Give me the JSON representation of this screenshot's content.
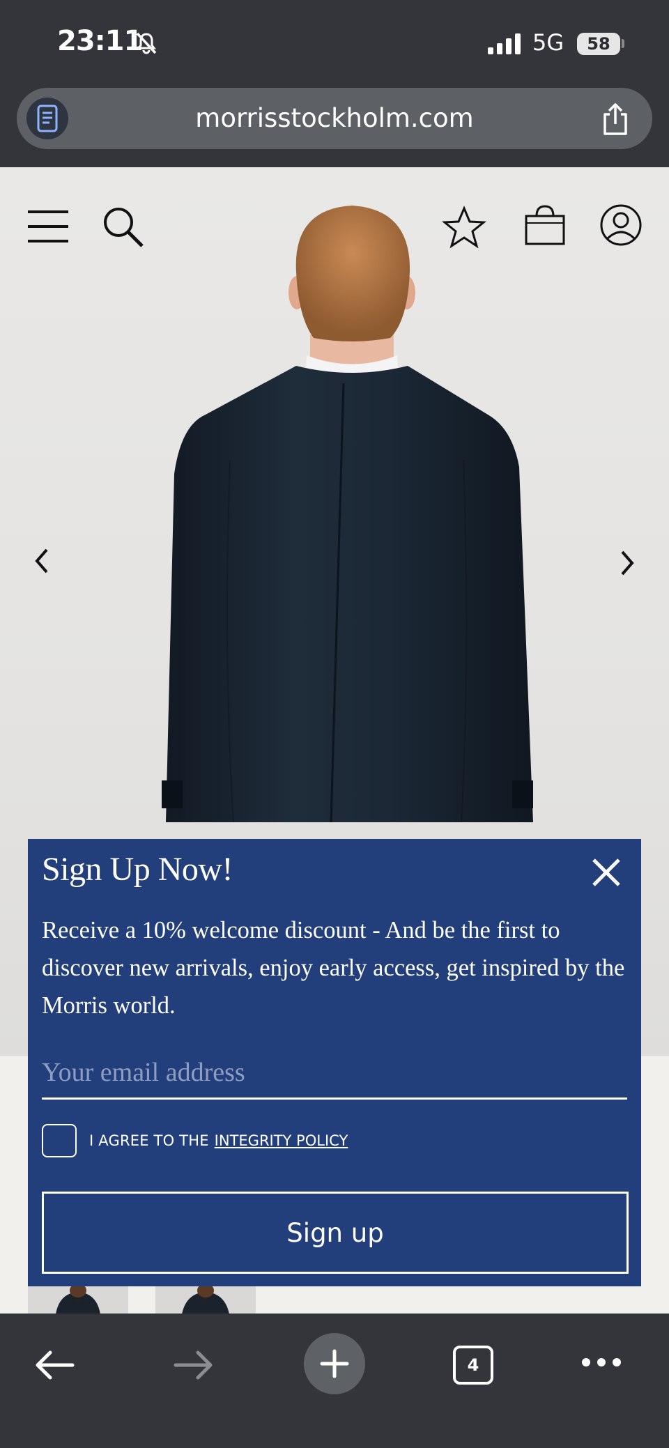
{
  "status_bar": {
    "time": "23:11",
    "network": "5G",
    "battery": "58",
    "icons": [
      "bell-muted-icon",
      "signal-icon",
      "battery-icon"
    ]
  },
  "browser": {
    "url": "morrisstockholm.com",
    "icons": [
      "reader-icon",
      "share-icon"
    ]
  },
  "site_header": {
    "icons": [
      "menu-icon",
      "search-icon",
      "favorite-icon",
      "bag-icon",
      "account-icon"
    ]
  },
  "carousel": {
    "icons": [
      "chevron-left-icon",
      "chevron-right-icon"
    ]
  },
  "popup": {
    "title": "Sign Up Now!",
    "text": "Receive a 10% welcome discount - And be the first to discover new arrivals, enjoy early access, get inspired by the Morris world.",
    "email_placeholder": "Your email address",
    "agree_prefix": "I AGREE TO THE",
    "agree_link": "INTEGRITY POLICY",
    "button_label": "Sign up",
    "background_color": "#233f7b"
  },
  "toolbar": {
    "tab_count": "4",
    "icons": [
      "back-icon",
      "forward-icon",
      "new-tab-icon",
      "tabs-icon",
      "more-icon"
    ]
  }
}
